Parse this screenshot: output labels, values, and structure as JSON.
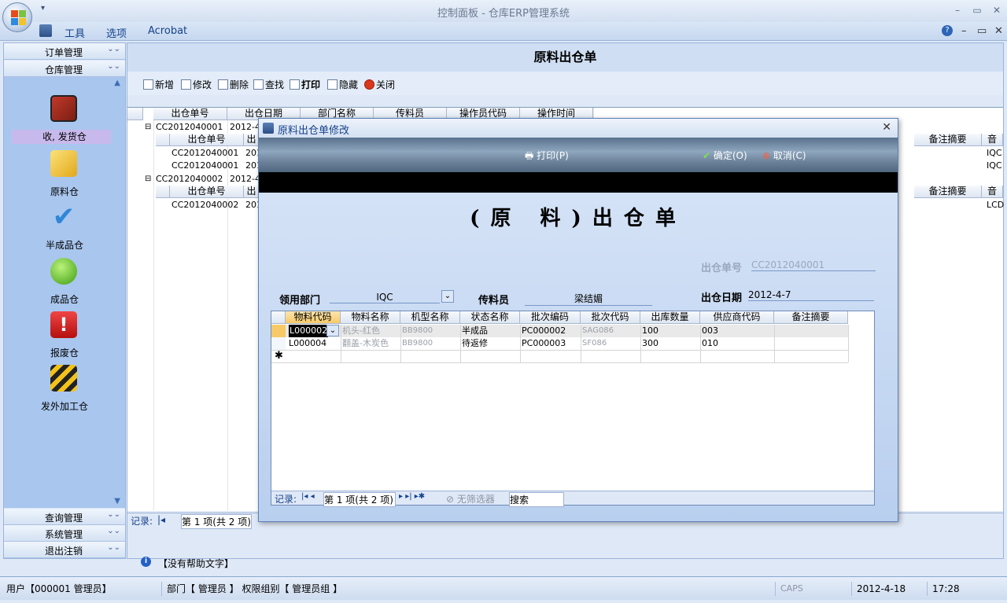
{
  "window": {
    "title": "控制面板 - 仓库ERP管理系统",
    "qa": "▾",
    "minimize": "–",
    "restore": "▭",
    "close": "✕"
  },
  "menu": {
    "items": [
      "工具",
      "选项",
      "Acrobat"
    ],
    "help": "?",
    "min": "–",
    "restore": "▭",
    "close": "✕"
  },
  "sidebar": {
    "groups_top": [
      "订单管理",
      "仓库管理"
    ],
    "items": [
      {
        "label": "收, 发货仓",
        "icon": "truck-icon",
        "selected": true
      },
      {
        "label": "原料仓",
        "icon": "folder-icon"
      },
      {
        "label": "半成品仓",
        "icon": "check-icon"
      },
      {
        "label": "成品仓",
        "icon": "apple-icon"
      },
      {
        "label": "报废仓",
        "icon": "alert-icon"
      },
      {
        "label": "发外加工仓",
        "icon": "hazard-stripes-icon"
      }
    ],
    "groups_bottom": [
      "查询管理",
      "系统管理",
      "退出注销"
    ]
  },
  "main": {
    "title": "原料出仓单",
    "toolbar": [
      "新增",
      "修改",
      "删除",
      "查找",
      "打印",
      "隐藏",
      "关闭"
    ],
    "grid_headers": [
      "出仓单号",
      "出仓日期",
      "部门名称",
      "传料员",
      "操作员代码",
      "操作时间"
    ],
    "right_headers": [
      "备注摘要",
      "音"
    ],
    "groups": [
      {
        "id": "CC2012040001",
        "date": "2012-4",
        "sub_header": "出仓单号",
        "sub_header2": "出",
        "rows": [
          "CC2012040001",
          "CC2012040001"
        ],
        "date_cells": [
          "201",
          "201"
        ],
        "right_cells": [
          "IQC",
          "IQC"
        ]
      },
      {
        "id": "CC2012040002",
        "date": "2012-4",
        "sub_header": "出仓单号",
        "sub_header2": "出",
        "rows": [
          "CC2012040002"
        ],
        "date_cells": [
          "201"
        ],
        "right_cells": [
          "LCD"
        ]
      }
    ],
    "record_bar": {
      "label": "记录:",
      "position": "第 1 项(共 2 项)"
    }
  },
  "dialog": {
    "title": "原料出仓单修改",
    "print": "打印(P)",
    "ok": "确定(O)",
    "cancel": "取消(C)",
    "heading": "(原 料)出仓单",
    "doc_no_label": "出仓单号",
    "doc_no": "CC2012040001",
    "dept_label": "领用部门",
    "dept": "IQC",
    "courier_label": "传料员",
    "courier": "梁结媚",
    "date_label": "出仓日期",
    "date": "2012-4-7",
    "columns": [
      "物料代码",
      "物料名称",
      "机型名称",
      "状态名称",
      "批次编码",
      "批次代码",
      "出库数量",
      "供应商代码",
      "备注摘要"
    ],
    "rows": [
      [
        "L000002",
        "机头-红色",
        "BB9800",
        "半成品",
        "PC000002",
        "SAG086",
        "100",
        "003",
        ""
      ],
      [
        "L000004",
        "翻盖-木炭色",
        "BB9800",
        "待返修",
        "PC000003",
        "SF086",
        "300",
        "010",
        ""
      ]
    ],
    "record_bar": {
      "label": "记录:",
      "position": "第 1 项(共 2 项)",
      "filter": "无筛选器",
      "search": "搜索"
    }
  },
  "help_text": "【没有帮助文字】",
  "status": {
    "user": "用户【000001 管理员】",
    "dept": "部门【 管理员 】 权限组别【 管理员组 】",
    "caps": "CAPS",
    "date": "2012-4-18",
    "time": "17:28"
  }
}
